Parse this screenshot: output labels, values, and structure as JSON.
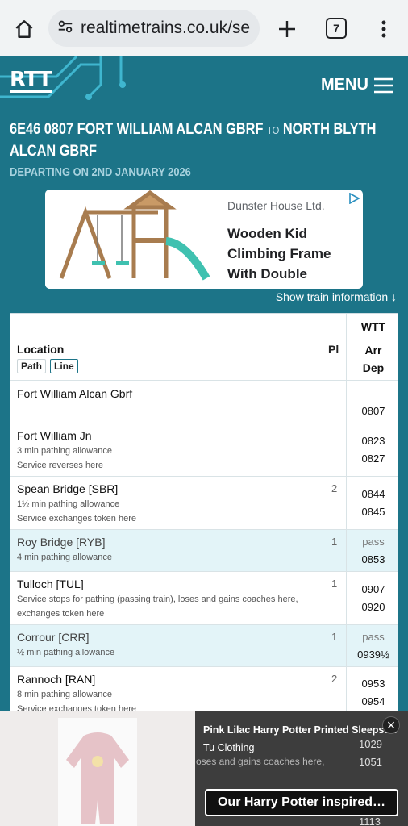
{
  "browser": {
    "url": "realtimetrains.co.uk/se",
    "tab_count": "7"
  },
  "header": {
    "logo": "RTT",
    "menu_label": "MENU"
  },
  "service": {
    "headcode_from": "6E46 0807 FORT WILLIAM ALCAN GBRF",
    "to_label": "TO",
    "destination": "NORTH BLYTH ALCAN GBRF",
    "departing": "DEPARTING ON 2ND JANUARY 2026"
  },
  "ad_top": {
    "brand": "Dunster House Ltd.",
    "headline": "Wooden Kid Climbing Frame With Double Swing…"
  },
  "show_info": "Show train information ↓",
  "table": {
    "col_location": "Location",
    "col_pl": "Pl",
    "col_wtt": "WTT",
    "col_arr": "Arr",
    "col_dep": "Dep",
    "chip_path": "Path",
    "chip_line": "Line",
    "rows": [
      {
        "location": "Fort William Alcan Gbrf",
        "notes": [],
        "pl": "",
        "arr": "",
        "dep": "0807",
        "pass": false
      },
      {
        "location": "Fort William Jn",
        "notes": [
          "3 min pathing allowance",
          "Service reverses here"
        ],
        "pl": "",
        "arr": "0823",
        "dep": "0827",
        "pass": false
      },
      {
        "location": "Spean Bridge [SBR]",
        "notes": [
          "1½ min pathing allowance",
          "Service exchanges token here"
        ],
        "pl": "2",
        "arr": "0844",
        "dep": "0845",
        "pass": false
      },
      {
        "location": "Roy Bridge [RYB]",
        "notes": [
          "4 min pathing allowance"
        ],
        "pl": "1",
        "arr": "pass",
        "dep": "0853",
        "pass": true
      },
      {
        "location": "Tulloch [TUL]",
        "notes": [
          "Service stops for pathing (passing train), loses and gains coaches here,",
          "exchanges token here"
        ],
        "pl": "1",
        "arr": "0907",
        "dep": "0920",
        "pass": false
      },
      {
        "location": "Corrour [CRR]",
        "notes": [
          "½ min pathing allowance"
        ],
        "pl": "1",
        "arr": "pass",
        "dep": "0939½",
        "pass": true
      },
      {
        "location": "Rannoch [RAN]",
        "notes": [
          "8 min pathing allowance",
          "Service exchanges token here"
        ],
        "pl": "2",
        "arr": "0953",
        "dep": "0954",
        "pass": false
      }
    ],
    "hidden_fragment": "oses and gains coaches here,",
    "hidden_times": [
      "1029",
      "1051",
      "1113"
    ]
  },
  "ad_bottom": {
    "title": "Pink Lilac Harry Potter Printed Sleepsuit",
    "brand": "Tu Clothing",
    "cta": "Our Harry Potter inspired…"
  }
}
